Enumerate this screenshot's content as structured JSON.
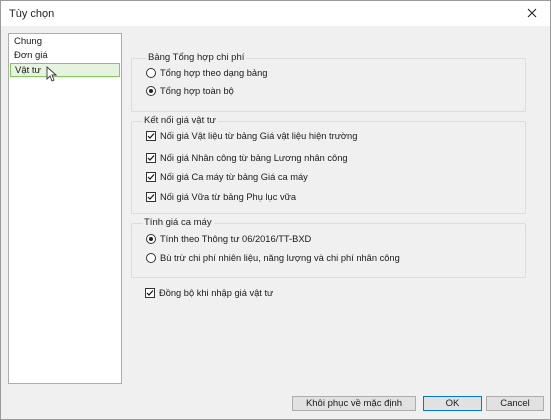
{
  "window": {
    "title": "Tùy chọn",
    "close_icon": "close-icon"
  },
  "sidebar": {
    "items": [
      {
        "label": "Chung"
      },
      {
        "label": "Đơn giá"
      },
      {
        "label": "Vật tư"
      }
    ]
  },
  "group_summary": {
    "title": "Bảng Tổng hợp chi phí",
    "options": [
      {
        "label": "Tổng hợp theo dạng bảng",
        "selected": false
      },
      {
        "label": "Tổng hợp toàn bộ",
        "selected": true
      }
    ]
  },
  "group_link": {
    "title": "Kết nối giá vật tư",
    "items": [
      {
        "label": "Nối giá Vật liệu từ bảng Giá vật liệu hiện trường",
        "checked": true
      },
      {
        "label": "Nối giá Nhân công từ bảng Lương nhân công",
        "checked": true
      },
      {
        "label": "Nối giá Ca máy từ bảng Giá ca máy",
        "checked": true
      },
      {
        "label": "Nối giá Vữa từ bảng Phụ lục vữa",
        "checked": true
      }
    ]
  },
  "group_machine": {
    "title": "Tính giá ca máy",
    "options": [
      {
        "label": "Tính theo Thông tư 06/2016/TT-BXD",
        "selected": true
      },
      {
        "label": "Bù trừ chi phí nhiên liệu, năng lượng và chi phí nhân công",
        "selected": false
      }
    ]
  },
  "sync": {
    "label": "Đồng bộ khi nhập giá vật tư",
    "checked": true
  },
  "buttons": {
    "restore": "Khôi phục về mặc định",
    "ok": "OK",
    "cancel": "Cancel"
  }
}
